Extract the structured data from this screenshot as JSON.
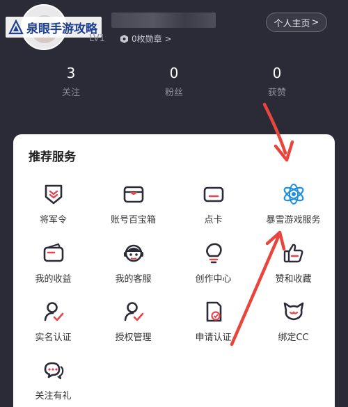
{
  "header": {
    "watermark_text": "泉眼手游攻略",
    "level": "LV1",
    "badge_label": "0枚勋章",
    "badge_chevron": ">",
    "profile_button": "个人主页",
    "profile_chevron": ">"
  },
  "stats": [
    {
      "value": "3",
      "label": "关注"
    },
    {
      "value": "0",
      "label": "粉丝"
    },
    {
      "value": "0",
      "label": "获赞"
    }
  ],
  "services": {
    "title": "推荐服务",
    "items": [
      {
        "label": "将军令",
        "icon": "shield-badge-icon"
      },
      {
        "label": "账号百宝箱",
        "icon": "treasure-box-icon"
      },
      {
        "label": "点卡",
        "icon": "card-icon"
      },
      {
        "label": "暴雪游戏服务",
        "icon": "blizzard-logo-icon"
      },
      {
        "label": "我的收益",
        "icon": "wallet-icon"
      },
      {
        "label": "我的客服",
        "icon": "customer-service-icon"
      },
      {
        "label": "创作中心",
        "icon": "lightbulb-icon"
      },
      {
        "label": "赞和收藏",
        "icon": "thumbs-up-icon"
      },
      {
        "label": "实名认证",
        "icon": "user-verified-icon"
      },
      {
        "label": "授权管理",
        "icon": "user-authorize-icon"
      },
      {
        "label": "申请认证",
        "icon": "document-check-icon"
      },
      {
        "label": "绑定CC",
        "icon": "cc-cat-icon"
      },
      {
        "label": "关注有礼",
        "icon": "chat-bubbles-icon"
      }
    ]
  },
  "colors": {
    "header_bg": "#2a2b37",
    "accent_red": "#e5454f",
    "arrow_red": "#e8463c",
    "blizzard_blue": "#1f8fe0"
  }
}
